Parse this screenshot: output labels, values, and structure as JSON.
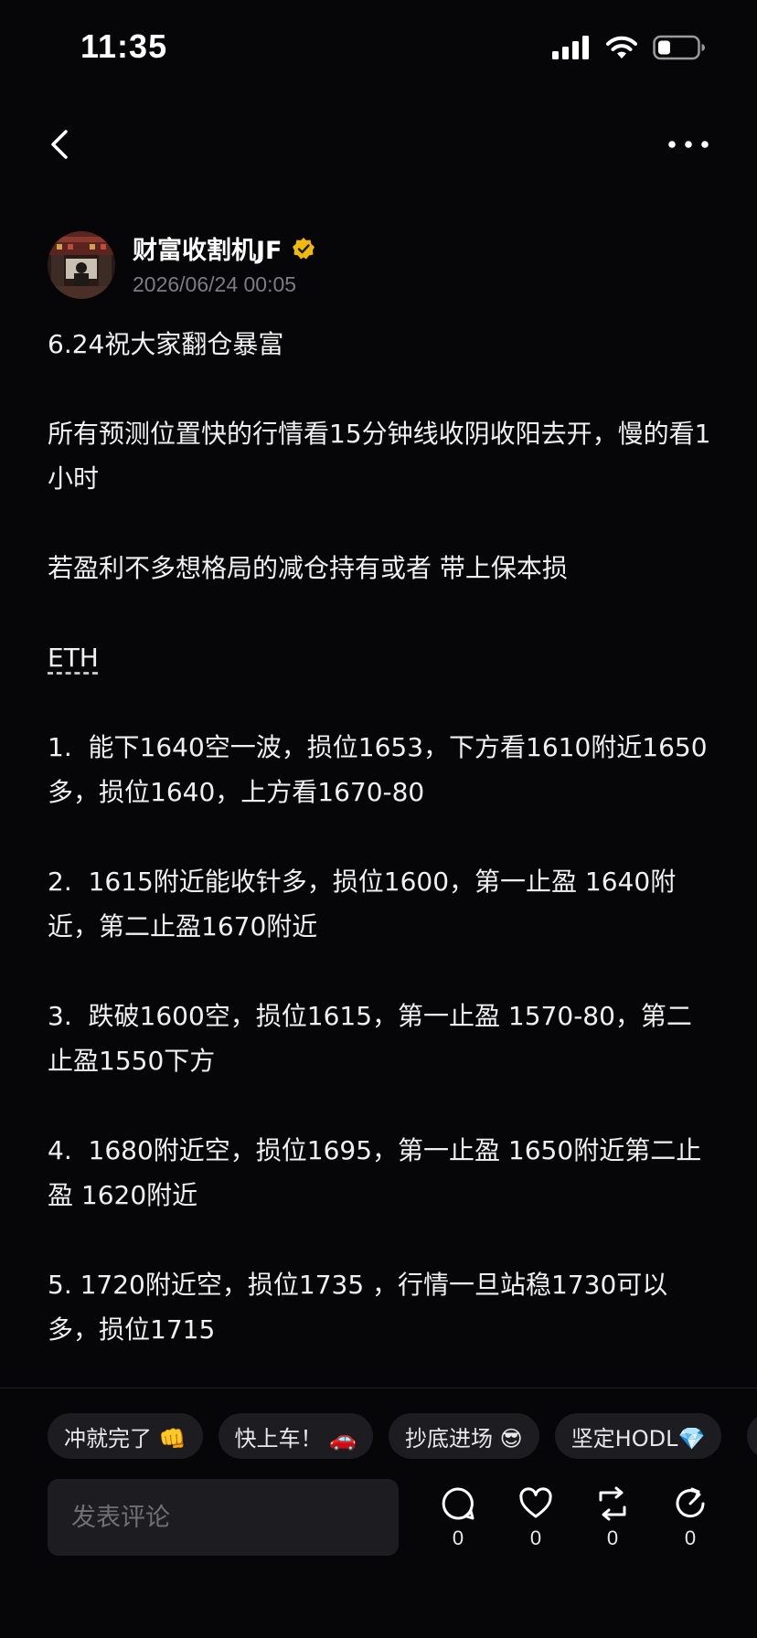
{
  "status_bar": {
    "time": "11:35",
    "icons": [
      "signal-icon",
      "wifi-icon",
      "battery-icon"
    ]
  },
  "nav": {
    "back_icon": "chevron-left-icon",
    "more_icon": "more-horizontal-icon"
  },
  "author": {
    "name": "财富收割机JF",
    "verified_icon": "verified-badge-icon",
    "timestamp": "2026/06/24 00:05"
  },
  "post": {
    "paragraphs": [
      "6.24祝大家翻仓暴富",
      "所有预测位置快的行情看15分钟线收阴收阳去开，慢的看1小时",
      "若盈利不多想格局的减仓持有或者 带上保本损",
      "ETH",
      "1.  能下1640空一波，损位1653，下方看1610附近1650多，损位1640，上方看1670-80",
      "2.  1615附近能收针多，损位1600，第一止盈 1640附近，第二止盈1670附近",
      "3.  跌破1600空，损位1615，第一止盈 1570-80，第二止盈1550下方",
      "4.  1680附近空，损位1695，第一止盈 1650附近第二止盈 1620附近",
      "5. 1720附近空，损位1735 ，行情一旦站稳1730可以多，损位1715"
    ]
  },
  "quick_replies": [
    "冲就完了 👊",
    "快上车！ 🚗",
    "抄底进场 😎",
    "坚定HODL💎"
  ],
  "comment": {
    "placeholder": "发表评论"
  },
  "actions": [
    {
      "icon": "comment-icon",
      "count": "0"
    },
    {
      "icon": "heart-icon",
      "count": "0"
    },
    {
      "icon": "repost-icon",
      "count": "0"
    },
    {
      "icon": "share-icon",
      "count": "0"
    }
  ],
  "colors": {
    "background": "#060608",
    "text": "#f0f0f0",
    "muted": "#7c7c82",
    "chip_bg": "#1d1d21",
    "verified": "#f0b90b"
  }
}
